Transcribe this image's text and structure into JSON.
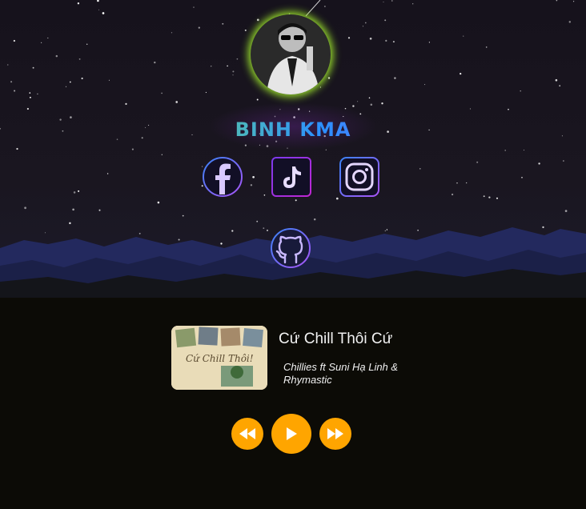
{
  "profile": {
    "name": "BINH KMA",
    "avatar_icon": "person-with-sunglasses-photo"
  },
  "social": [
    {
      "id": "facebook",
      "icon": "facebook-icon"
    },
    {
      "id": "tiktok",
      "icon": "tiktok-icon"
    },
    {
      "id": "instagram",
      "icon": "instagram-icon"
    },
    {
      "id": "github",
      "icon": "github-icon"
    }
  ],
  "player": {
    "title": "Cứ Chill Thôi   Cứ",
    "artist": "Chillies ft Suni Hạ Linh & Rhymastic",
    "cover_text": "Cứ Chill Thôi!",
    "controls": {
      "prev": "rewind-icon",
      "play": "play-icon",
      "next": "fast-forward-icon"
    }
  },
  "colors": {
    "accent": "#ffa500",
    "avatar_glow": "#9be22d",
    "icon_gradient_start": "#7c3aed",
    "icon_gradient_end": "#3b82f6"
  }
}
